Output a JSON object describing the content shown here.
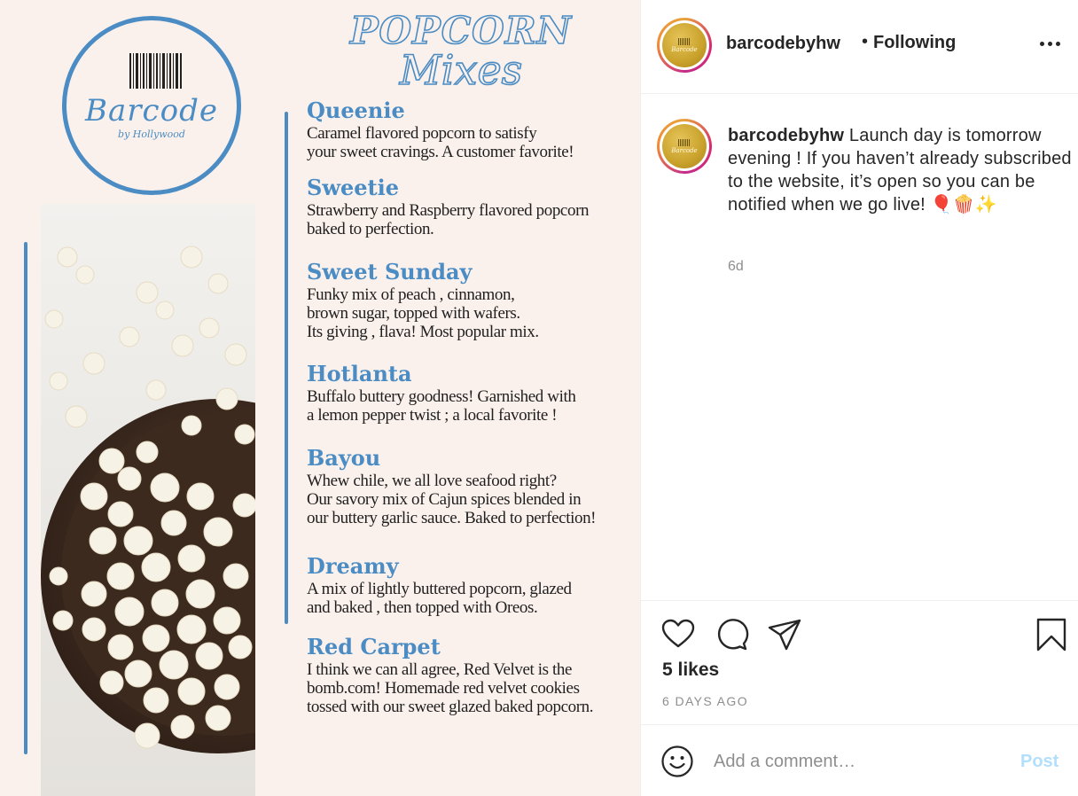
{
  "post_image": {
    "logo": {
      "name": "Barcode",
      "sub": "by Hollywood"
    },
    "headline": {
      "line1": "POPCORN",
      "line2": "Mixes"
    },
    "menu": [
      {
        "title": "Queenie",
        "desc": "Caramel flavored popcorn to satisfy\nyour sweet cravings. A customer favorite!"
      },
      {
        "title": "Sweetie",
        "desc": "Strawberry and Raspberry flavored popcorn\nbaked to perfection."
      },
      {
        "title": "Sweet Sunday",
        "desc": "Funky mix of peach , cinnamon,\nbrown sugar, topped with wafers.\nIts giving , flava! Most popular mix."
      },
      {
        "title": "Hotlanta",
        "desc": "Buffalo buttery goodness! Garnished with\na lemon pepper twist ; a local favorite !"
      },
      {
        "title": "Bayou",
        "desc": "Whew chile, we all love seafood right?\nOur savory mix of Cajun spices blended in\nour buttery garlic sauce. Baked to perfection!"
      },
      {
        "title": "Dreamy",
        "desc": " A mix of lightly buttered popcorn, glazed\nand baked , then topped with Oreos."
      },
      {
        "title": "Red Carpet",
        "desc": "I think we can all agree, Red Velvet is the\nbomb.com! Homemade red velvet cookies\n tossed with our sweet glazed baked popcorn."
      }
    ]
  },
  "header": {
    "username": "barcodebyhw",
    "dot": "•",
    "follow_status": "Following"
  },
  "caption": {
    "username": "barcodebyhw",
    "text": "Launch day is tomorrow evening ! If you haven’t already subscribed to the website, it’s open so you can be notified when we go live! 🎈🍿✨",
    "time": "6d"
  },
  "engagement": {
    "likes": "5 likes",
    "date": "6 DAYS AGO"
  },
  "comment": {
    "placeholder": "Add a comment…",
    "post_label": "Post"
  },
  "colors": {
    "brand_blue": "#4a8cc3",
    "post_button_disabled": "#b2dffc",
    "muted_text": "#8e8e8e"
  }
}
